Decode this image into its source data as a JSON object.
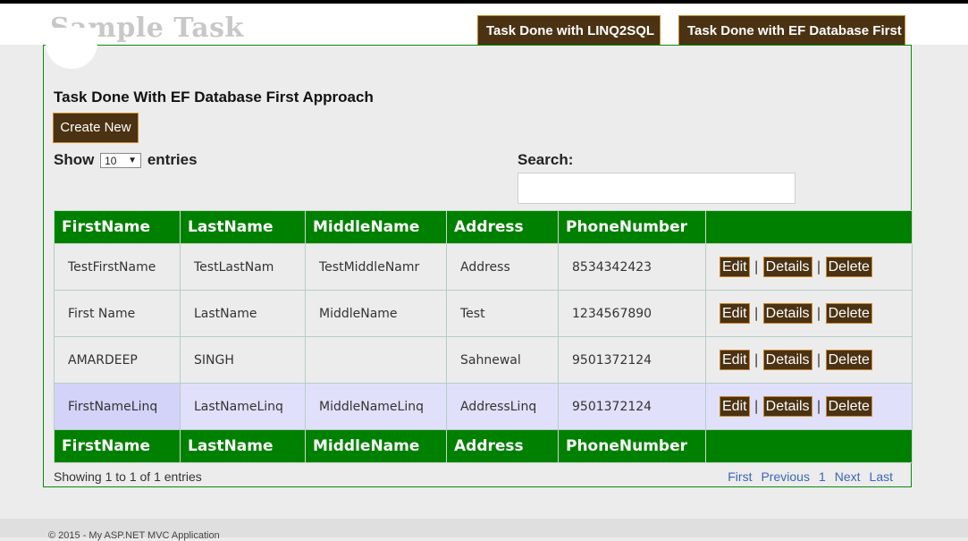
{
  "site_title": "Sample Task",
  "nav": {
    "linq_label": "Task Done with LINQ2SQL",
    "ef_label": "Task Done with EF Database First"
  },
  "panel": {
    "title": "Task Done With EF Database First Approach",
    "create_label": "Create New"
  },
  "length": {
    "show_label": "Show",
    "value": "10",
    "entries_label": "entries"
  },
  "search": {
    "label": "Search:",
    "value": ""
  },
  "table": {
    "headers": [
      "FirstName",
      "LastName",
      "MiddleName",
      "Address",
      "PhoneNumber",
      ""
    ],
    "rows": [
      {
        "first": "TestFirstName",
        "last": "TestLastNam",
        "middle": "TestMiddleNamr",
        "address": "Address",
        "phone": "8534342423"
      },
      {
        "first": "First Name",
        "last": "LastName",
        "middle": "MiddleName",
        "address": "Test",
        "phone": "1234567890"
      },
      {
        "first": "AMARDEEP",
        "last": "SINGH",
        "middle": "",
        "address": "Sahnewal",
        "phone": "9501372124"
      },
      {
        "first": "FirstNameLinq",
        "last": "LastNameLinq",
        "middle": "MiddleNameLinq",
        "address": "AddressLinq",
        "phone": "9501372124"
      }
    ],
    "actions": {
      "edit": "Edit",
      "details": "Details",
      "delete": "Delete",
      "separator": "|"
    }
  },
  "info": "Showing 1 to 1 of 1 entries",
  "pager": {
    "first": "First",
    "previous": "Previous",
    "page": "1",
    "next": "Next",
    "last": "Last"
  },
  "footer": "© 2015 - My ASP.NET MVC Application",
  "colors": {
    "accent_brown": "#4a3213",
    "header_green": "#008000",
    "link_blue": "#3a66b5"
  }
}
